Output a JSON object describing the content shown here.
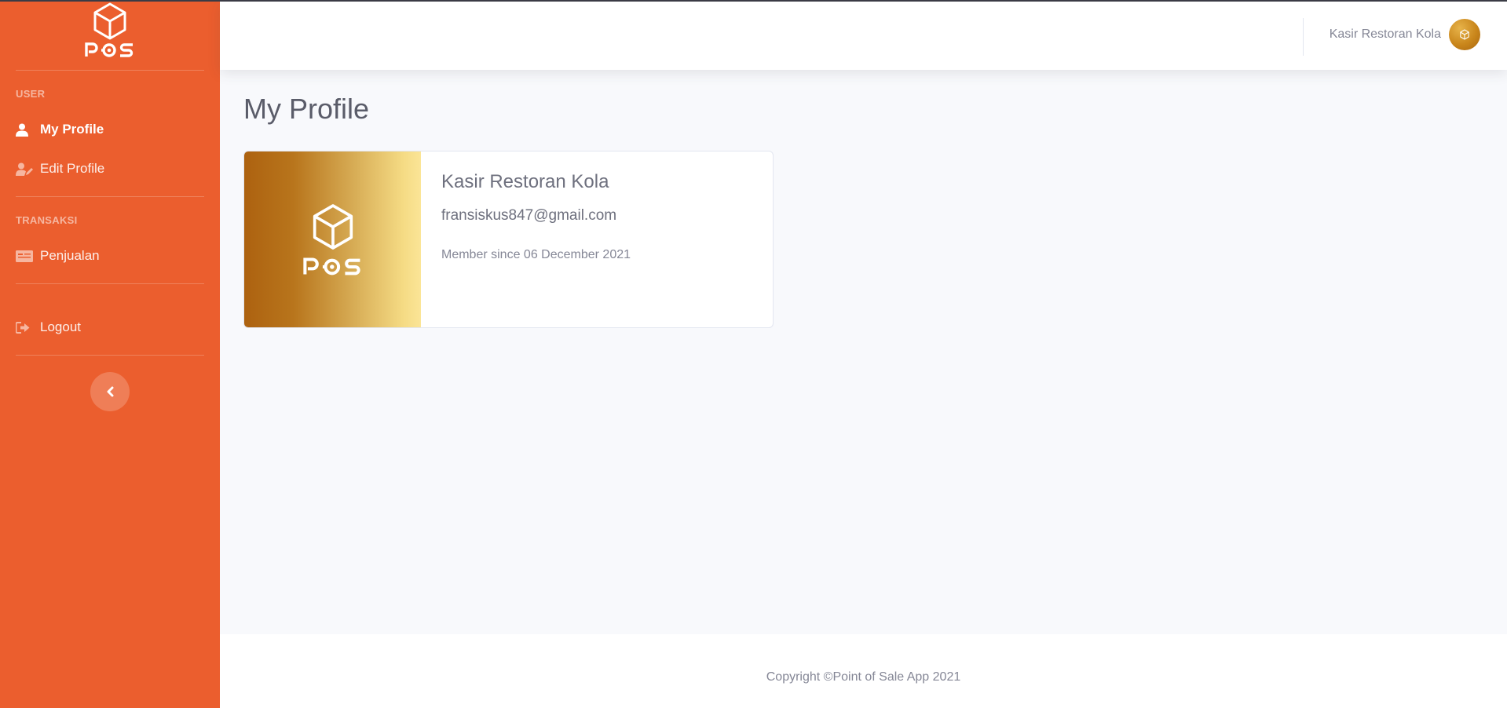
{
  "app": {
    "brand_name": "POS"
  },
  "colors": {
    "sidebar": "#eb5e2e",
    "background": "#f8f9fc",
    "card_gradient_start": "#ad6210",
    "card_gradient_end": "#fbe597"
  },
  "sidebar": {
    "sections": [
      {
        "heading": "USER",
        "items": [
          {
            "label": "My Profile",
            "icon": "user-icon",
            "active": true
          },
          {
            "label": "Edit Profile",
            "icon": "user-edit-icon",
            "active": false
          }
        ]
      },
      {
        "heading": "TRANSAKSI",
        "items": [
          {
            "label": "Penjualan",
            "icon": "receipt-icon",
            "active": false
          }
        ]
      }
    ],
    "logout_label": "Logout",
    "toggle_icon": "chevron-left-icon"
  },
  "topbar": {
    "user_name": "Kasir Restoran Kola"
  },
  "main": {
    "page_title": "My Profile",
    "profile": {
      "name": "Kasir Restoran Kola",
      "email": "fransiskus847@gmail.com",
      "member_since": "Member since 06 December 2021"
    }
  },
  "footer": {
    "copyright": "Copyright ©Point of Sale App 2021"
  }
}
